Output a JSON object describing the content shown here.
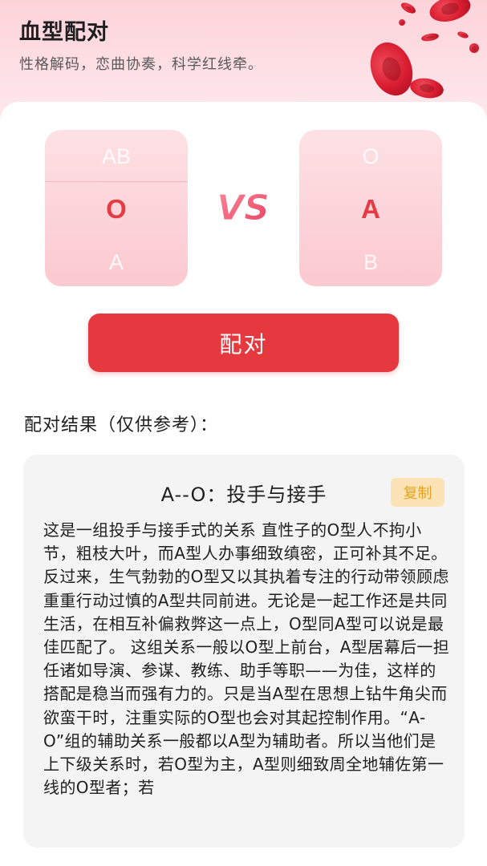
{
  "header": {
    "title": "血型配对",
    "subtitle": "性格解码，恋曲协奏，科学红线牵。"
  },
  "picker_left": {
    "options": [
      "AB",
      "O",
      "A"
    ],
    "selected": "O"
  },
  "picker_right": {
    "options": [
      "O",
      "A",
      "B"
    ],
    "selected": "A"
  },
  "vs_text": "VS",
  "match_button": "配对",
  "result_label": "配对结果（仅供参考）：",
  "result": {
    "title": "A--O：投手与接手",
    "copy_button": "复制",
    "body": "这是一组投手与接手式的关系 直性子的O型人不拘小节，粗枝大叶，而A型人办事细致缜密，正可补其不足。反过来，生气勃勃的O型又以其执着专注的行动带领顾虑重重行动过慎的A型共同前进。无论是一起工作还是共同生活，在相互补偏救弊这一点上，O型同A型可以说是最佳匹配了。 这组关系一般以O型上前台，A型居幕后一担任诸如导演、参谋、教练、助手等职——为佳，这样的搭配是稳当而强有力的。只是当A型在思想上钻牛角尖而欲蛮干时，注重实际的O型也会对其起控制作用。“A-O”组的辅助关系一般都以A型为辅助者。所以当他们是上下级关系时，若O型为主，A型则细致周全地辅佐第一线的O型者；若"
  },
  "colors": {
    "accent": "#e5393f",
    "selected_text": "#e53b44",
    "copy_bg": "#fbe3b5",
    "copy_text": "#e9a21e"
  }
}
